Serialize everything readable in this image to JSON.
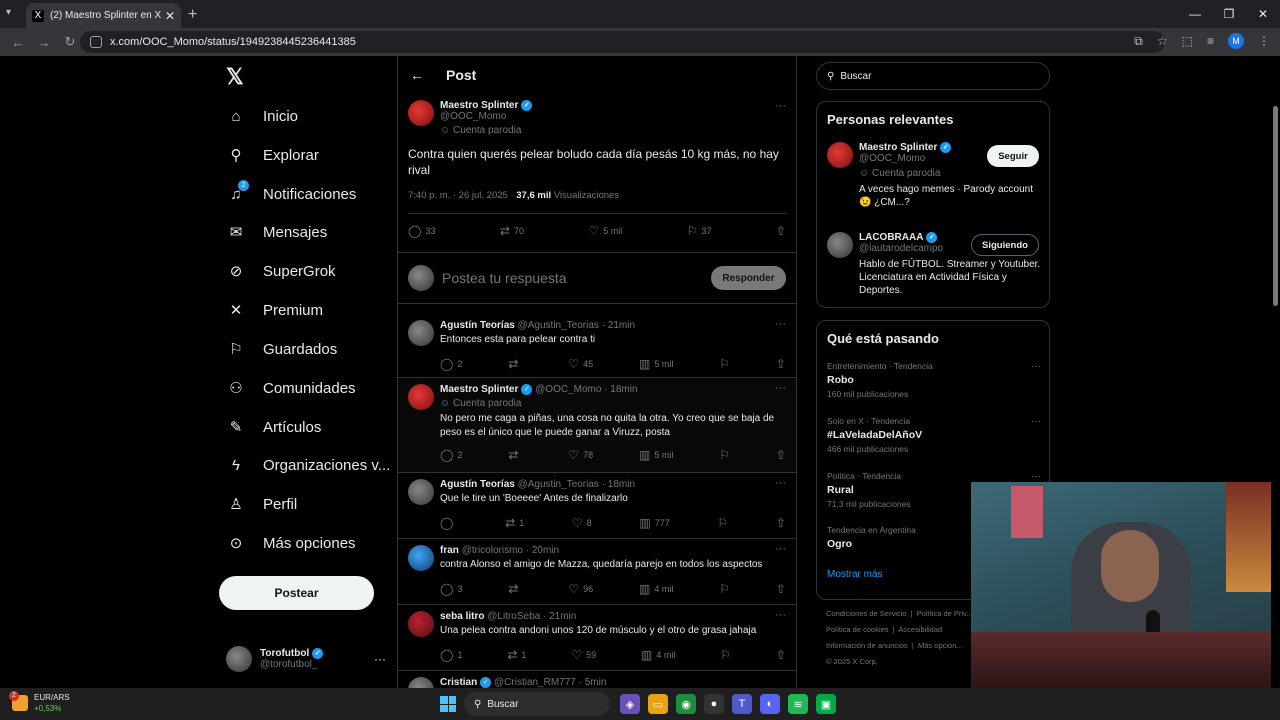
{
  "browser": {
    "tab_title": "(2) Maestro Splinter en X: \"@la...",
    "url": "x.com/OOC_Momo/status/1949238445236441385",
    "profile_initial": "M"
  },
  "nav": {
    "items": [
      {
        "label": "Inicio",
        "icon": "home-icon"
      },
      {
        "label": "Explorar",
        "icon": "search-icon"
      },
      {
        "label": "Notificaciones",
        "icon": "bell-icon",
        "badge": "2"
      },
      {
        "label": "Mensajes",
        "icon": "mail-icon"
      },
      {
        "label": "SuperGrok",
        "icon": "grok-icon"
      },
      {
        "label": "Premium",
        "icon": "x-logo-icon"
      },
      {
        "label": "Guardados",
        "icon": "bookmark-icon"
      },
      {
        "label": "Comunidades",
        "icon": "people-icon"
      },
      {
        "label": "Artículos",
        "icon": "article-icon"
      },
      {
        "label": "Organizaciones v...",
        "icon": "lightning-icon"
      },
      {
        "label": "Perfil",
        "icon": "person-icon"
      },
      {
        "label": "Más opciones",
        "icon": "more-circle-icon"
      }
    ],
    "post_button": "Postear",
    "account": {
      "name": "Torofutbol",
      "handle": "@torofutbol_"
    }
  },
  "header": {
    "title": "Post"
  },
  "main_post": {
    "name": "Maestro Splinter",
    "handle": "@OOC_Momo",
    "label": "Cuenta parodia",
    "text": "Contra quien querés pelear boludo cada día pesás 10 kg más, no hay rival",
    "time": "7:40 p. m. · 26 jul. 2025 · ",
    "views": "37,6 mil",
    "views_label": " Visualizaciones",
    "replies": "33",
    "reposts": "70",
    "likes": "5 mil",
    "bookmarks": "37"
  },
  "composer": {
    "placeholder": "Postea tu respuesta",
    "button": "Responder"
  },
  "replies": [
    {
      "name": "Agustín Teorías",
      "handle": "@Agustin_Teorias · 21min",
      "label": "",
      "text": "Entonces esta para pelear contra ti",
      "replies": "2",
      "reposts": "",
      "likes": "45",
      "views": "5 mil"
    },
    {
      "name": "Maestro Splinter",
      "handle": "@OOC_Momo · 18min",
      "label": "Cuenta parodia",
      "text": "No pero me caga a piñas, una cosa no quita la otra. Yo creo que se baja de peso es el único que le puede ganar a Viruzz, posta",
      "replies": "2",
      "reposts": "",
      "likes": "78",
      "views": "5 mil"
    },
    {
      "name": "Agustín Teorías",
      "handle": "@Agustin_Teorias · 18min",
      "label": "",
      "text": "Que le tire un 'Boeeee' Antes de finalizarlo",
      "replies": "",
      "reposts": "1",
      "likes": "8",
      "views": "777"
    },
    {
      "name": "fran",
      "handle": "@tricolorismo · 20min",
      "label": "",
      "text": "contra Alonso el amigo de Mazza, quedaría parejo en todos los aspectos",
      "replies": "3",
      "reposts": "",
      "likes": "96",
      "views": "4 mil"
    },
    {
      "name": "seba litro",
      "handle": "@LitroSeba · 21min",
      "label": "",
      "text": "Una pelea contra andoni unos 120 de músculo y el otro de grasa jahaja",
      "replies": "1",
      "reposts": "1",
      "likes": "59",
      "views": "4 mil"
    },
    {
      "name": "Cristian",
      "handle": "@Cristian_RM777 · 5min",
      "label": "",
      "text": "",
      "replies": "",
      "reposts": "",
      "likes": "",
      "views": ""
    }
  ],
  "right": {
    "search_placeholder": "Buscar",
    "relevant_title": "Personas relevantes",
    "people": [
      {
        "name": "Maestro Splinter",
        "handle": "@OOC_Momo",
        "label": "Cuenta parodia",
        "bio": "A veces hago memes · Parody account 😉 ¿CM...?",
        "button": "Seguir"
      },
      {
        "name": "LACOBRAAA",
        "handle": "@lautarodelcampo",
        "label": "",
        "bio": "Hablo de FÚTBOL. Streamer y Youtuber. Licenciatura en Actividad Física y Deportes.",
        "button": "Siguiendo"
      }
    ],
    "trending_title": "Qué está pasando",
    "trends": [
      {
        "context": "Entretenimiento · Tendencia",
        "name": "Robo",
        "posts": "160 mil publicaciones"
      },
      {
        "context": "Solo en X · Tendencia",
        "name": "#LaVeladaDelAñoV",
        "posts": "466 mil publicaciones"
      },
      {
        "context": "Política · Tendencia",
        "name": "Rural",
        "posts": "71,3 mil publicaciones"
      },
      {
        "context": "Tendencia en Argentina",
        "name": "Ogro",
        "posts": ""
      }
    ],
    "show_more": "Mostrar más",
    "footer": [
      "Condiciones de Servicio",
      "Política de Priv...",
      "Política de cookies",
      "Accesibilidad",
      "Información de anuncios",
      "Más opcion...",
      "© 2025 X Corp."
    ]
  },
  "taskbar": {
    "ticker": "EUR/ARS",
    "change": "+0,53%",
    "ticker_badge": "2",
    "search": "Buscar"
  }
}
